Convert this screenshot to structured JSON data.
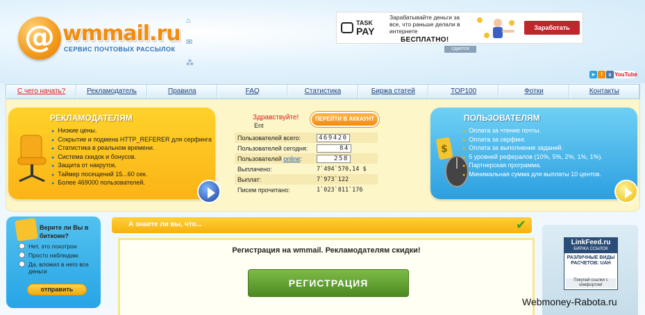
{
  "header": {
    "logo_mark": "@",
    "logo_name": "wmmail.ru",
    "logo_slogan": "СЕРВИС ПОЧТОВЫХ РАССЫЛОК",
    "icons": [
      "home-icon",
      "mail-icon",
      "network-icon"
    ]
  },
  "banner": {
    "brand_small": "TASK",
    "brand_big": "PAY",
    "copy": "Зарабатывайте деньги за все, что раньше делали в интернете",
    "free": "БЕСПЛАТНО!",
    "button": "Заработать",
    "note": "сдается"
  },
  "social": {
    "icons": [
      "telegram-icon",
      "facebook-icon",
      "vk-icon",
      "youtube-icon"
    ],
    "youtube_label": "YouTube"
  },
  "nav": [
    {
      "label": "С чего начать?"
    },
    {
      "label": "Рекламодатель"
    },
    {
      "label": "Правила"
    },
    {
      "label": "FAQ"
    },
    {
      "label": "Статистика"
    },
    {
      "label": "Биржа статей"
    },
    {
      "label": "TOP100"
    },
    {
      "label": "Фотки"
    },
    {
      "label": "Контакты"
    }
  ],
  "advertisers": {
    "title": "РЕКЛАМОДАТЕЛЯМ",
    "items": [
      "Низкие цены.",
      "Сокрытие и подмена HTTP_REFERER для серфинга",
      "Статистика в реальном времени.",
      "Система скидок и бонусов.",
      "Защита от накруток.",
      "Таймер посещений 15...60 сек.",
      "Более 469000 пользователей."
    ]
  },
  "users": {
    "title": "ПОЛЬЗОВАТЕЛЯМ",
    "items": [
      "Оплата за чтение почты.",
      "Оплата за серфинг.",
      "Оплата за выполнение заданий.",
      "5 уровней рефералов (10%, 5%, 2%, 1%, 1%).",
      "Партнерская программа.",
      "Минимальная сумма для выплаты 10 центов."
    ]
  },
  "center": {
    "greeting": "Здравствуйте!",
    "username": "Ent",
    "account_button": "ПЕРЕЙТИ В АККАУНТ",
    "stats": {
      "total_label": "Пользователей всего:",
      "total_value": "469420",
      "today_label": "Пользователей сегодня:",
      "today_value": "84",
      "online_label_pre": "Пользователей ",
      "online_link": "online",
      "online_label_post": ":",
      "online_value": "258",
      "paid_label": "Выплачено:",
      "paid_value": "7`494`570,14 $",
      "payout_label": "Выплат:",
      "payout_value": "7`973`122",
      "letters_label": "Писем прочитано:",
      "letters_value": "1`023`811`176"
    }
  },
  "poll": {
    "question": "Верите ли Вы в биткоин?",
    "options": [
      "Нет, это лохотрон",
      "Просто наблюдаю",
      "Да, вложил в него все деньги"
    ],
    "vote_button": "отправить"
  },
  "did_you_know": {
    "title": "А знаете ли вы, что..."
  },
  "registration": {
    "headline": "Регистрация на wmmail. Рекламодателям скидки!",
    "button": "РЕГИСТРАЦИЯ"
  },
  "linkfeed": {
    "name": "LinkFeed.ru",
    "tagline": "БИРЖА ССЫЛОК",
    "body": "РАЗЛИЧНЫЕ ВИДЫ РАСЧЕТОВ: UAH",
    "footer": "Покупай ссылки с комфортом!"
  },
  "watermark": "Webmoney-Rabota.ru",
  "colors": {
    "accent_orange": "#f28d0d",
    "nav_link": "#1b3f7a",
    "nav_active": "#e01616",
    "register_green": "#4c8a22"
  }
}
